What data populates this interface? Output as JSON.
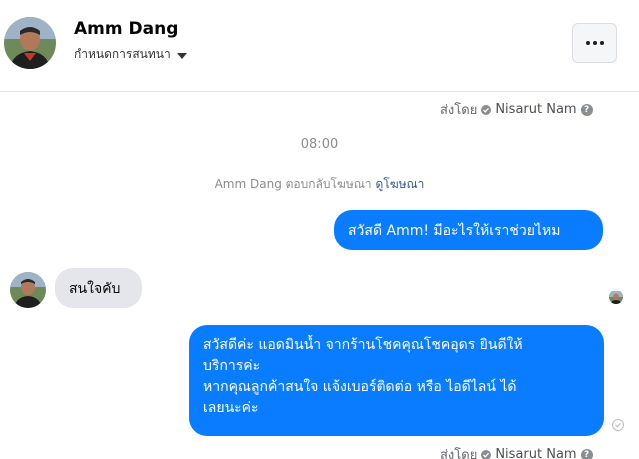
{
  "header": {
    "contact_name": "Amm Dang",
    "conversation_settings_label": "กำหนดการสนทนา",
    "more_icon": "more-horizontal-icon"
  },
  "sent_by": {
    "label": "ส่งโดย",
    "agent_name": "Nisarut Nam"
  },
  "thread": {
    "timestamp": "08:00",
    "ad_reply_text": "Amm Dang ตอบกลับโฆษณา",
    "ad_link": "ดูโฆษณา"
  },
  "messages": [
    {
      "direction": "outgoing",
      "text": "สวัสดี Amm! มีอะไรให้เราช่วยไหม"
    },
    {
      "direction": "incoming",
      "text": "สนใจคับ"
    },
    {
      "direction": "outgoing",
      "lines": [
        "สวัสดีค่ะ แอดมินน้ำ จากร้านโชคคุณโชคอุดร ยินดีให้",
        "บริการค่ะ",
        "หากคุณลูกค้าสนใจ แจ้งเบอร์ติดต่อ หรือ ไอดีไลน์ ได้",
        "เลยนะค่ะ"
      ]
    }
  ],
  "colors": {
    "outgoing_bubble": "#0a7cff",
    "incoming_bubble": "#e4e6eb",
    "link": "#385898"
  }
}
